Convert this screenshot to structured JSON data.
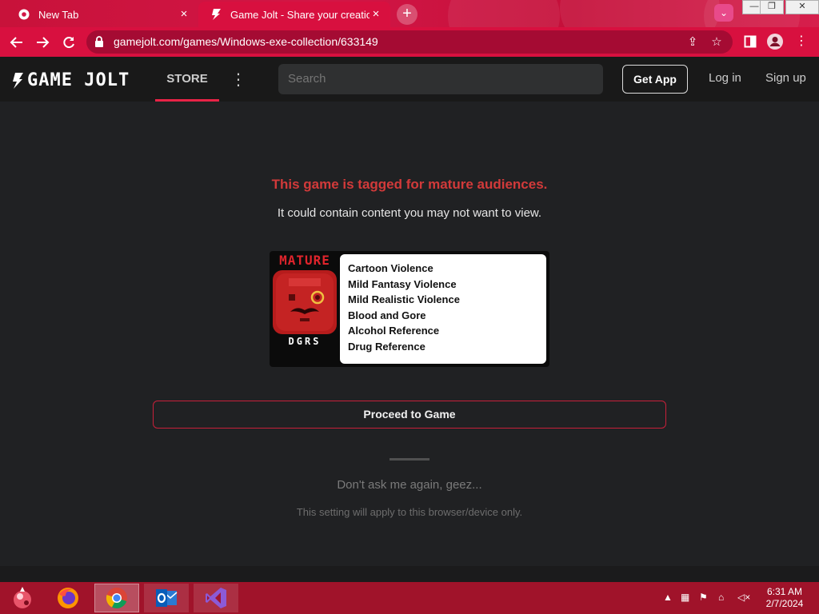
{
  "browser": {
    "tabs": [
      {
        "title": "New Tab",
        "favicon": "chrome-icon"
      },
      {
        "title": "Game Jolt - Share your creations",
        "favicon": "gamejolt-icon"
      }
    ],
    "url": "gamejolt.com/games/Windows-exe-collection/633149"
  },
  "site": {
    "logo": "GAME JOLT",
    "store_label": "STORE",
    "search_placeholder": "Search",
    "get_app_label": "Get App",
    "login_label": "Log in",
    "signup_label": "Sign up"
  },
  "warning": {
    "title": "This game is tagged for mature audiences.",
    "subtitle": "It could contain content you may not want to view.",
    "badge_top": "MATURE",
    "badge_bottom": "DGRS",
    "descriptors": [
      "Cartoon Violence",
      "Mild Fantasy Violence",
      "Mild Realistic Violence",
      "Blood and Gore",
      "Alcohol Reference",
      "Drug Reference"
    ],
    "proceed_label": "Proceed to Game",
    "dont_ask_label": "Don't ask me again, geez...",
    "setting_note": "This setting will apply to this browser/device only."
  },
  "taskbar": {
    "time": "6:31 AM",
    "date": "2/7/2024",
    "apps": [
      "start-icon",
      "firefox-icon",
      "chrome-icon",
      "outlook-icon",
      "visual-studio-icon"
    ]
  },
  "colors": {
    "accent": "#e82346",
    "warning": "#d23a3a",
    "browser_frame": "#d8103f",
    "taskbar": "#a0132a"
  }
}
